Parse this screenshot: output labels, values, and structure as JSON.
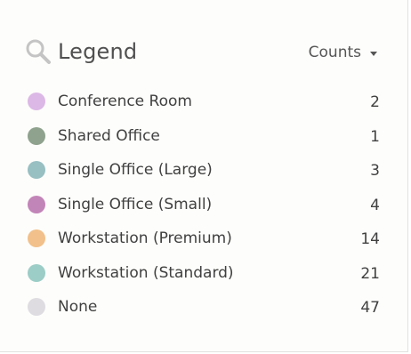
{
  "legend": {
    "title": "Legend",
    "icon": "search-icon",
    "sort": {
      "label": "Counts",
      "icon": "caret-down-icon"
    },
    "items": [
      {
        "label": "Conference Room",
        "count": "2",
        "color": "#dcb8e6"
      },
      {
        "label": "Shared Office",
        "count": "1",
        "color": "#8fa28e"
      },
      {
        "label": "Single Office (Large)",
        "count": "3",
        "color": "#98bfc2"
      },
      {
        "label": "Single Office (Small)",
        "count": "4",
        "color": "#c285b8"
      },
      {
        "label": "Workstation (Premium)",
        "count": "14",
        "color": "#f2c08a"
      },
      {
        "label": "Workstation (Standard)",
        "count": "21",
        "color": "#9ccdc6"
      },
      {
        "label": "None",
        "count": "47",
        "color": "#dedce1"
      }
    ]
  }
}
